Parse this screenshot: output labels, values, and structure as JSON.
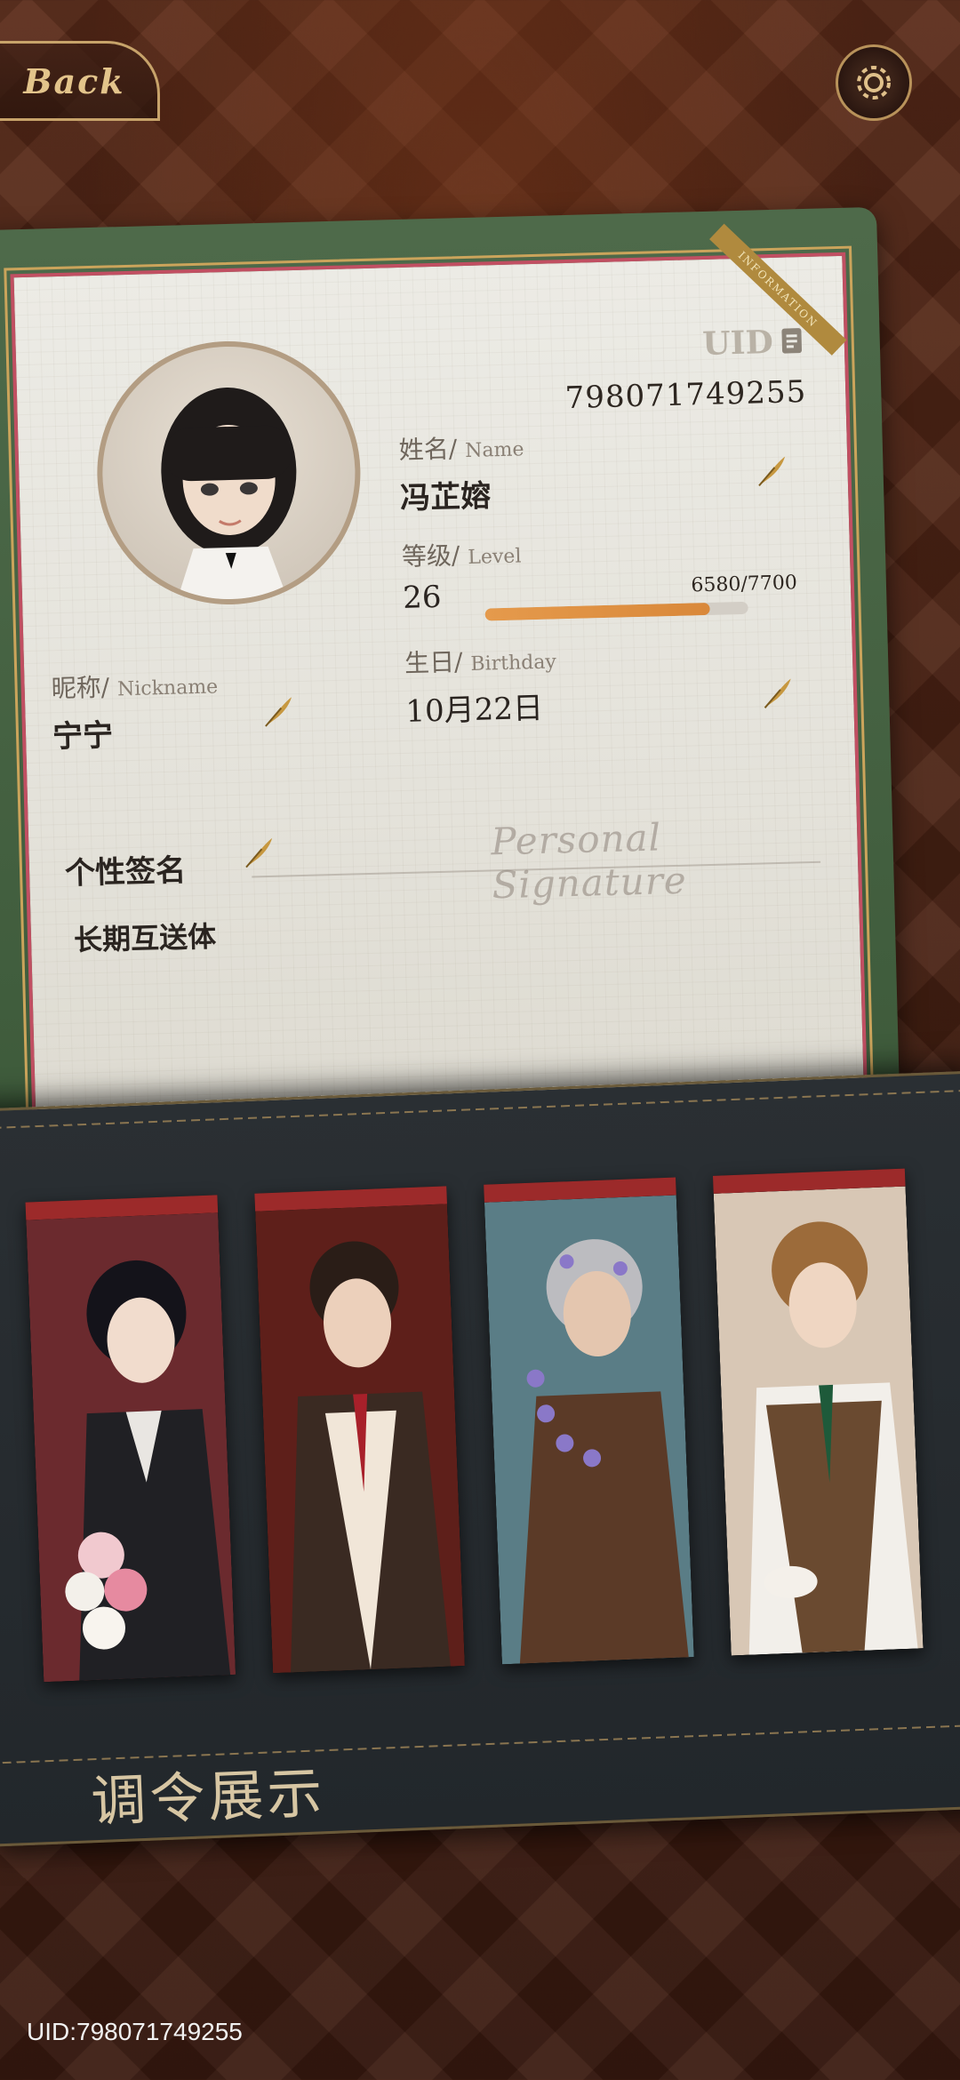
{
  "nav": {
    "back_label": "Back"
  },
  "profile": {
    "uid_label": "UID",
    "uid_value": "798071749255",
    "ribbon_text": "INFORMATION",
    "name_label": "姓名/",
    "name_label_en": "Name",
    "name_value": "冯芷嫆",
    "level_label": "等级/",
    "level_label_en": "Level",
    "level_value": "26",
    "level_exp": "6580/7700",
    "level_progress": 0.8545,
    "birthday_label": "生日/",
    "birthday_label_en": "Birthday",
    "birthday_value": "10月22日",
    "nickname_label": "昵称/",
    "nickname_label_en": "Nickname",
    "nickname_value": "宁宁",
    "signature_label": "个性签名",
    "signature_deco": "Personal Signature",
    "signature_value": "长期互送体"
  },
  "showcase": {
    "title": "调令展示",
    "cards": [
      {
        "name": "character-card-1"
      },
      {
        "name": "character-card-2"
      },
      {
        "name": "character-card-3"
      },
      {
        "name": "character-card-4"
      }
    ]
  },
  "footer": {
    "uid_text": "UID:798071749255"
  },
  "colors": {
    "accent_orange": "#e59a4c",
    "card_green": "#4e6a4a",
    "ribbon_red": "#9c2a2a"
  }
}
